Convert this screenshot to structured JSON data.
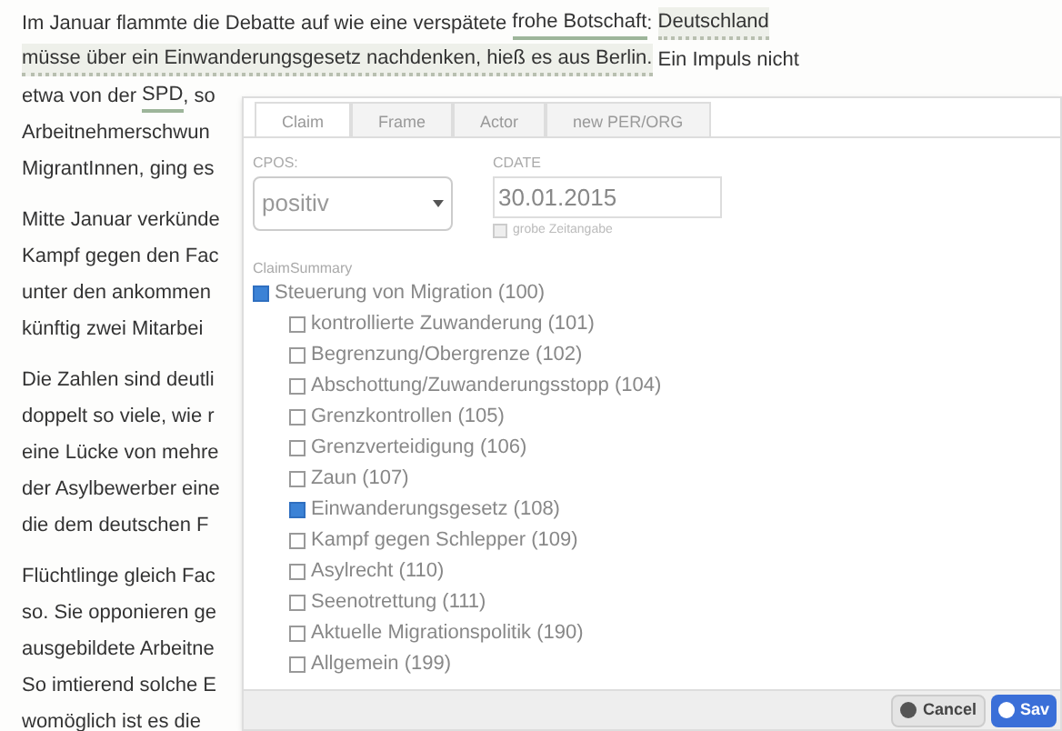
{
  "article": {
    "paragraphs": [
      {
        "lines": [
          [
            {
              "text": "Im Januar flammte die Debatte auf wie eine verspätete ",
              "kind": "plain"
            },
            {
              "text": "frohe Botschaft",
              "kind": "underlined"
            },
            {
              "text": ": ",
              "kind": "plain"
            },
            {
              "text": "Deutschland",
              "kind": "highlighted"
            }
          ],
          [
            {
              "text": "müsse über ein Einwanderungsgesetz nachdenken, hieß es aus Berlin.",
              "kind": "highlighted"
            },
            {
              "text": " Ein Impuls nicht",
              "kind": "plain"
            }
          ],
          [
            {
              "text": "etwa von der ",
              "kind": "plain"
            },
            {
              "text": "SPD",
              "kind": "underlined"
            },
            {
              "text": ", so",
              "kind": "plain"
            }
          ],
          [
            {
              "text": "Arbeitnehmerschwun",
              "kind": "plain"
            }
          ],
          [
            {
              "text": "MigrantInnen, ging es",
              "kind": "plain"
            }
          ]
        ]
      },
      {
        "lines": [
          [
            {
              "text": "Mitte Januar verkünde",
              "kind": "plain"
            }
          ],
          [
            {
              "text": "Kampf gegen den Fac",
              "kind": "plain"
            }
          ],
          [
            {
              "text": "unter den ankommen",
              "kind": "plain"
            }
          ],
          [
            {
              "text": "künftig zwei Mitarbei",
              "kind": "plain"
            }
          ]
        ]
      },
      {
        "lines": [
          [
            {
              "text": "Die Zahlen sind deutli",
              "kind": "plain"
            }
          ],
          [
            {
              "text": "doppelt so viele, wie r",
              "kind": "plain"
            }
          ],
          [
            {
              "text": "eine Lücke von mehre",
              "kind": "plain"
            }
          ],
          [
            {
              "text": "der Asylbewerber eine",
              "kind": "plain"
            }
          ],
          [
            {
              "text": "die dem deutschen F",
              "kind": "plain"
            }
          ]
        ]
      },
      {
        "lines": [
          [
            {
              "text": "Flüchtlinge gleich Fac",
              "kind": "plain"
            }
          ],
          [
            {
              "text": "so. Sie opponieren ge",
              "kind": "plain"
            }
          ],
          [
            {
              "text": "ausgebildete Arbeitne",
              "kind": "plain"
            }
          ],
          [
            {
              "text": "So imtierend solche E",
              "kind": "plain"
            }
          ],
          [
            {
              "text": "womöglich ist es die",
              "kind": "plain"
            }
          ]
        ]
      }
    ]
  },
  "dialog": {
    "tabs": [
      {
        "label": "Claim",
        "selected": true
      },
      {
        "label": "Frame",
        "selected": false
      },
      {
        "label": "Actor",
        "selected": false
      },
      {
        "label": "new PER/ORG",
        "selected": false
      }
    ],
    "cpos": {
      "label": "CPOS:",
      "value": "positiv"
    },
    "cdate": {
      "label": "CDATE",
      "value": "30.01.2015",
      "rough_label": "grobe Zeitangabe",
      "rough_checked": false
    },
    "summary": {
      "label": "ClaimSummary",
      "tree": [
        {
          "label": "Steuerung von Migration (100)",
          "checked": true,
          "children": [
            {
              "label": "kontrollierte Zuwanderung (101)",
              "checked": false
            },
            {
              "label": "Begrenzung/Obergrenze (102)",
              "checked": false
            },
            {
              "label": "Abschottung/Zuwanderungsstopp (104)",
              "checked": false
            },
            {
              "label": "Grenzkontrollen (105)",
              "checked": false
            },
            {
              "label": "Grenzverteidigung (106)",
              "checked": false
            },
            {
              "label": "Zaun (107)",
              "checked": false
            },
            {
              "label": "Einwanderungsgesetz (108)",
              "checked": true
            },
            {
              "label": "Kampf gegen Schlepper (109)",
              "checked": false
            },
            {
              "label": "Asylrecht (110)",
              "checked": false
            },
            {
              "label": "Seenotrettung (111)",
              "checked": false
            },
            {
              "label": "Aktuelle Migrationspolitik (190)",
              "checked": false
            },
            {
              "label": "Allgemein (199)",
              "checked": false
            }
          ]
        }
      ]
    },
    "buttons": [
      {
        "label": "Cancel",
        "kind": "cancel"
      },
      {
        "label": "Sav",
        "kind": "save"
      }
    ]
  }
}
